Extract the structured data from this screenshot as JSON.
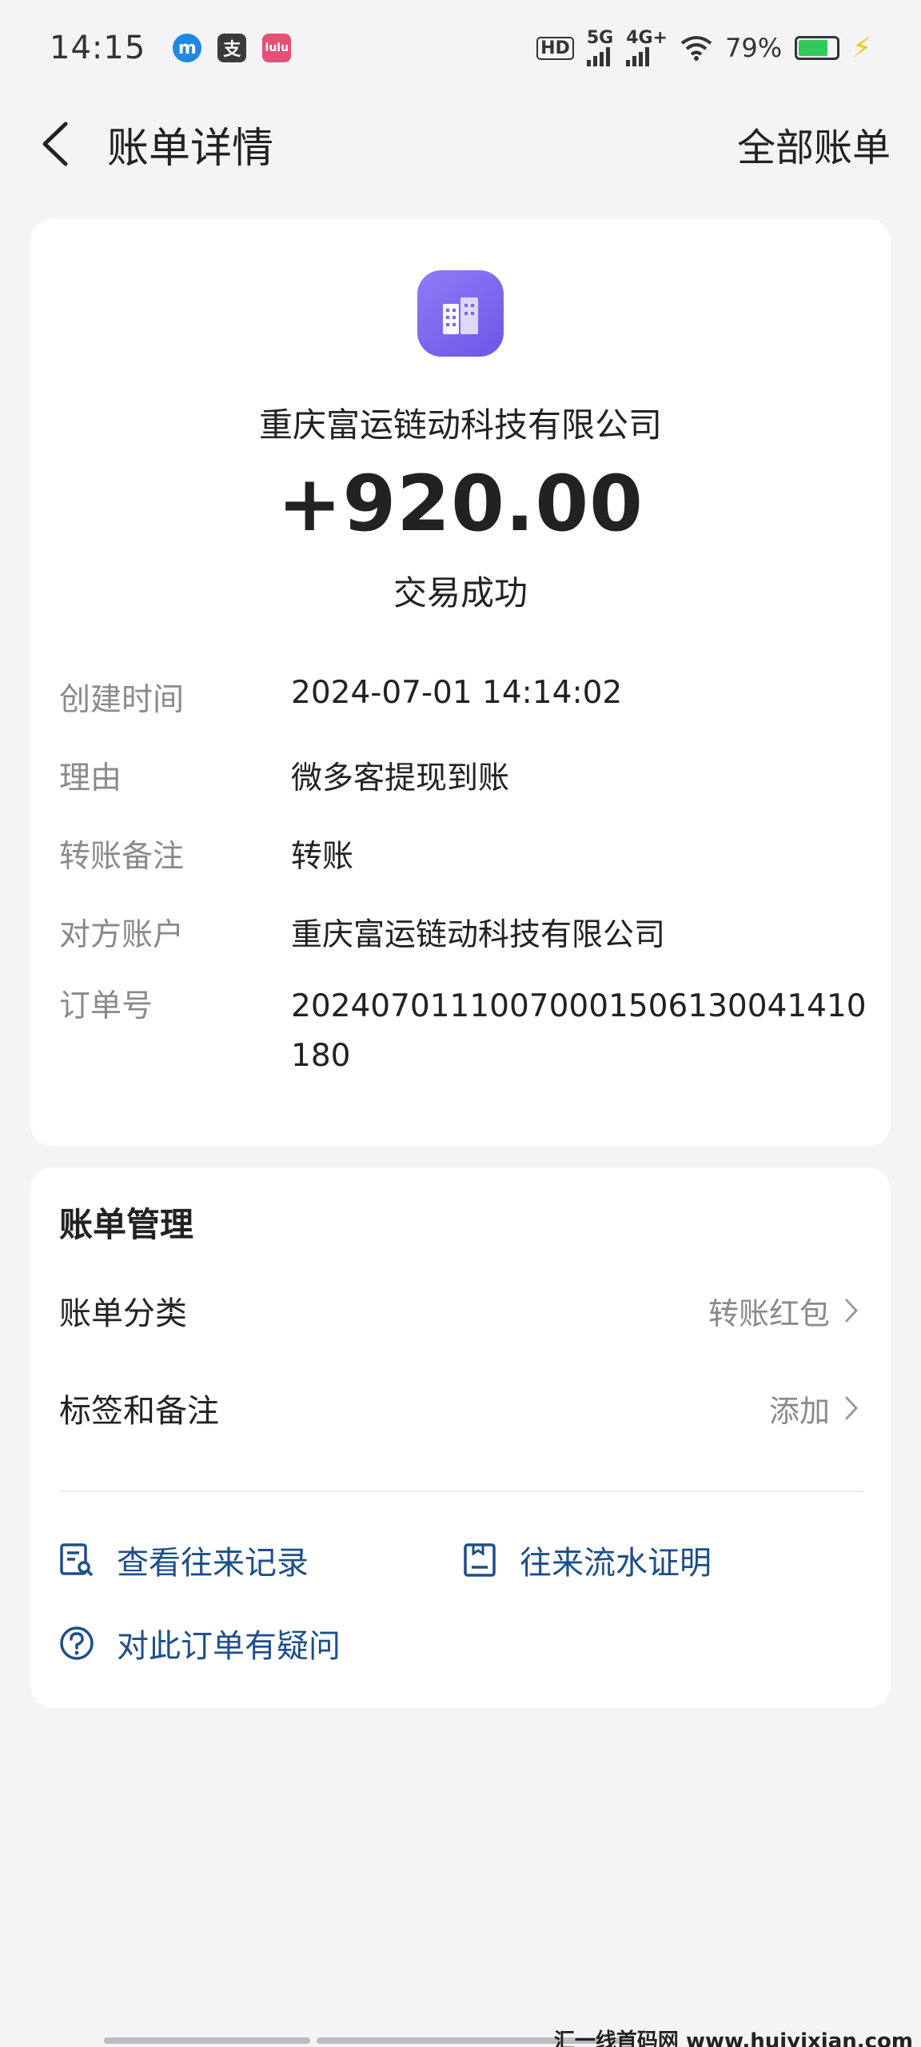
{
  "status_bar": {
    "time": "14:15",
    "badge_1": "m",
    "badge_2": "支",
    "badge_3": "lulu",
    "hd": "HD",
    "net_5g": "5G",
    "net_4g": "4G+",
    "battery": "79%",
    "battery_level": 0.79
  },
  "header": {
    "title": "账单详情",
    "all_bills": "全部账单"
  },
  "transaction": {
    "merchant": "重庆富运链动科技有限公司",
    "amount": "+920.00",
    "status": "交易成功"
  },
  "details": [
    {
      "label": "创建时间",
      "value": "2024-07-01 14:14:02"
    },
    {
      "label": "理由",
      "value": "微多客提现到账"
    },
    {
      "label": "转账备注",
      "value": "转账"
    },
    {
      "label": "对方账户",
      "value": "重庆富运链动科技有限公司"
    },
    {
      "label": "订单号",
      "value": "20240701110070001506130041410180"
    }
  ],
  "manage": {
    "title": "账单管理",
    "category_label": "账单分类",
    "category_value": "转账红包",
    "tag_label": "标签和备注",
    "tag_value": "添加",
    "records_link": "查看往来记录",
    "proof_link": "往来流水证明",
    "question_link": "对此订单有疑问"
  },
  "watermark": "汇一线首码网 www.huiyixian.com",
  "colors": {
    "accent_link": "#1d4f8a",
    "logo_gradient": "#7b66f0",
    "battery_green": "#2fca5a"
  }
}
